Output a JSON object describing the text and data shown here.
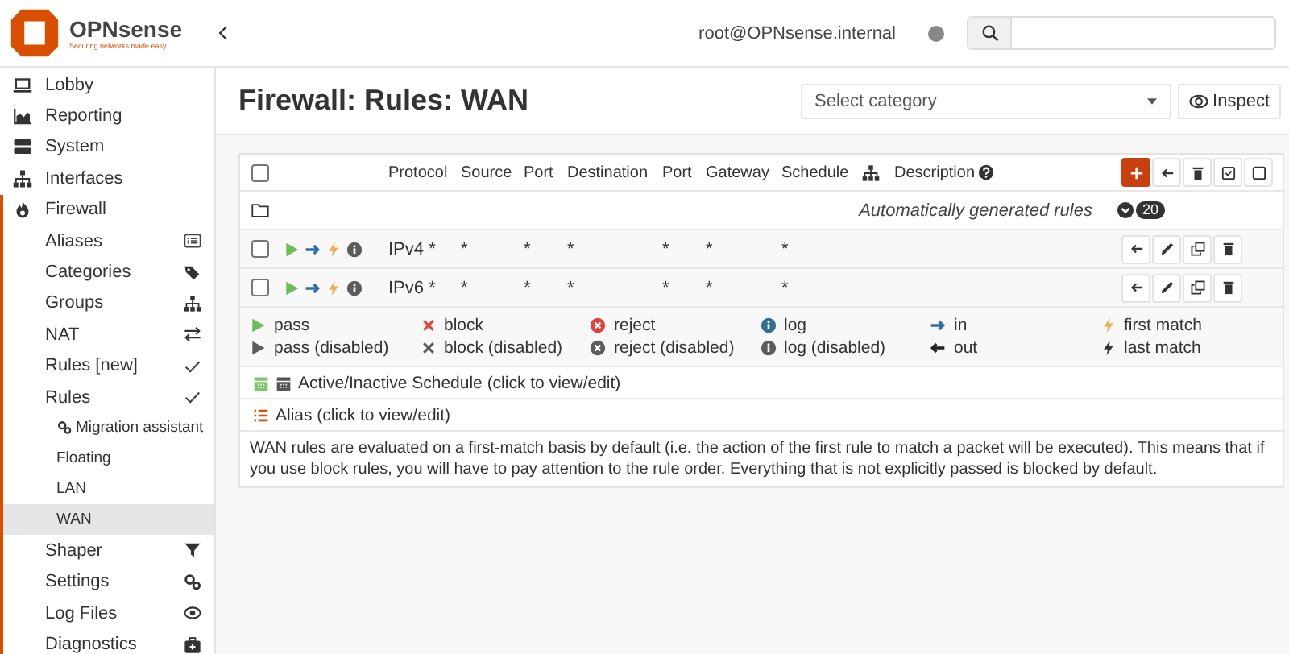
{
  "header": {
    "brand": "OPNsense",
    "tagline": "Securing networks made easy",
    "user": "root@OPNsense.internal"
  },
  "sidebar": {
    "items": [
      {
        "label": "Lobby",
        "selected": false
      },
      {
        "label": "Reporting",
        "selected": false
      },
      {
        "label": "System",
        "selected": false
      },
      {
        "label": "Interfaces",
        "selected": false
      },
      {
        "label": "Firewall",
        "selected": false,
        "expanded": true,
        "children": [
          {
            "label": "Aliases",
            "selected": false
          },
          {
            "label": "Categories",
            "selected": false
          },
          {
            "label": "Groups",
            "selected": false
          },
          {
            "label": "NAT",
            "selected": false
          },
          {
            "label": "Rules [new]",
            "selected": false
          },
          {
            "label": "Rules",
            "selected": false,
            "expanded": true,
            "children": [
              {
                "label": "Migration assistant",
                "selected": false
              },
              {
                "label": "Floating",
                "selected": false
              },
              {
                "label": "LAN",
                "selected": false
              },
              {
                "label": "WAN",
                "selected": true
              }
            ]
          },
          {
            "label": "Shaper",
            "selected": false
          },
          {
            "label": "Settings",
            "selected": false
          },
          {
            "label": "Log Files",
            "selected": false
          },
          {
            "label": "Diagnostics",
            "selected": false
          }
        ]
      }
    ]
  },
  "page": {
    "title": "Firewall: Rules: WAN",
    "category_select": {
      "placeholder": "Select category"
    },
    "inspect_button": "Inspect"
  },
  "table": {
    "header_checkbox": {
      "checked": false
    },
    "columns": [
      "Protocol",
      "Source",
      "Port",
      "Destination",
      "Port",
      "Gateway",
      "Schedule",
      "Description"
    ],
    "group": {
      "description": "Automatically generated rules",
      "count": "20",
      "expanded": false
    },
    "rows": [
      {
        "checked": false,
        "icons": [
          {
            "kind": "pass",
            "disabled": false
          },
          {
            "kind": "in",
            "disabled": false
          },
          {
            "kind": "first",
            "disabled": false
          },
          {
            "kind": "log",
            "disabled": true
          }
        ],
        "cells": [
          "IPv4 *",
          "*",
          "*",
          "*",
          "*",
          "*",
          "*"
        ]
      },
      {
        "checked": false,
        "icons": [
          {
            "kind": "pass",
            "disabled": false
          },
          {
            "kind": "in",
            "disabled": false
          },
          {
            "kind": "first",
            "disabled": false
          },
          {
            "kind": "log",
            "disabled": true
          }
        ],
        "cells": [
          "IPv6 *",
          "*",
          "*",
          "*",
          "*",
          "*",
          "*"
        ]
      }
    ]
  },
  "legend": [
    {
      "kind": "pass",
      "disabled": false,
      "label": "pass"
    },
    {
      "kind": "pass",
      "disabled": true,
      "label": "pass (disabled)"
    },
    {
      "kind": "block",
      "disabled": false,
      "label": "block"
    },
    {
      "kind": "block",
      "disabled": true,
      "label": "block (disabled)"
    },
    {
      "kind": "reject",
      "disabled": false,
      "label": "reject"
    },
    {
      "kind": "reject",
      "disabled": true,
      "label": "reject (disabled)"
    },
    {
      "kind": "log",
      "disabled": false,
      "label": "log"
    },
    {
      "kind": "log",
      "disabled": true,
      "label": "log (disabled)"
    },
    {
      "kind": "in",
      "disabled": false,
      "label": "in"
    },
    {
      "kind": "out",
      "disabled": false,
      "label": "out"
    },
    {
      "kind": "first",
      "disabled": false,
      "label": "first match"
    },
    {
      "kind": "last",
      "disabled": false,
      "label": "last match"
    }
  ],
  "schedule_legend": "Active/Inactive Schedule (click to view/edit)",
  "alias_legend": "Alias (click to view/edit)",
  "note": "WAN rules are evaluated on a first-match basis by default (i.e. the action of the first rule to match a packet will be executed). This means that if you use block rules, you will have to pay attention to the rule order. Everything that is not explicitly passed is blocked by default."
}
